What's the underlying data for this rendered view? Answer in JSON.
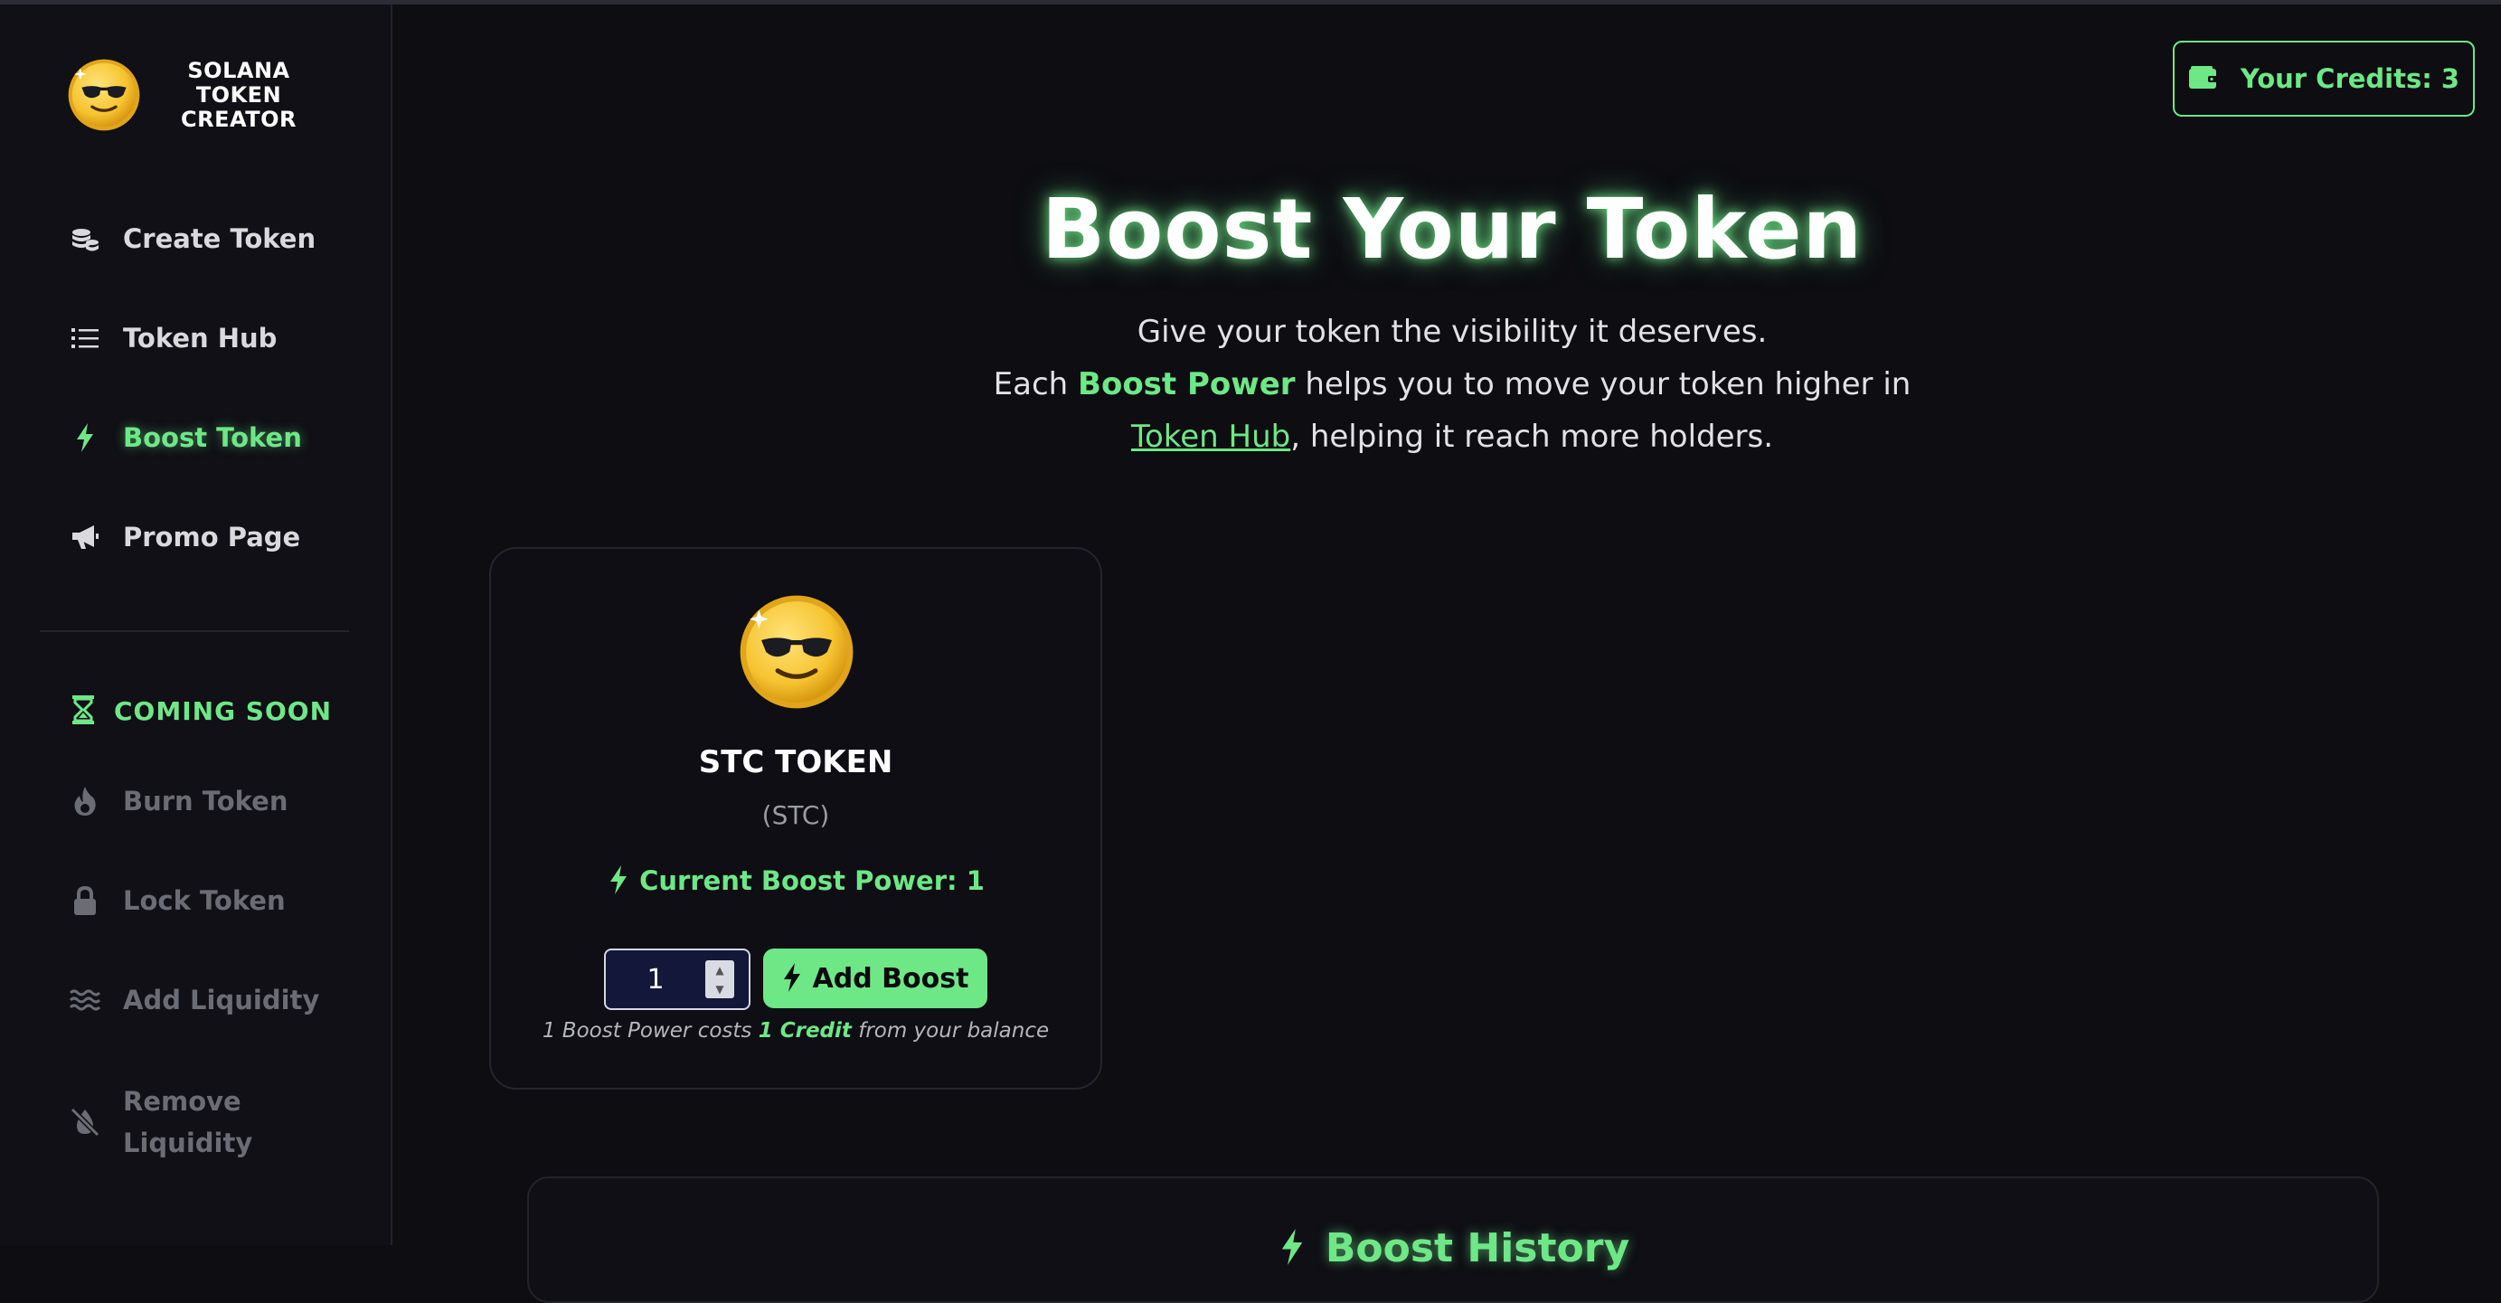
{
  "brand": {
    "name": "SOLANA TOKEN CREATOR",
    "logo_icon": "sunglasses-coin-icon"
  },
  "sidebar": {
    "items": [
      {
        "label": "Create Token",
        "icon": "coins-stack-icon",
        "state": "normal"
      },
      {
        "label": "Token Hub",
        "icon": "list-icon",
        "state": "normal"
      },
      {
        "label": "Boost Token",
        "icon": "bolt-icon",
        "state": "active"
      },
      {
        "label": "Promo Page",
        "icon": "megaphone-icon",
        "state": "normal"
      }
    ],
    "coming_soon_label": "COMING SOON",
    "coming_soon_items": [
      {
        "label": "Burn Token",
        "icon": "flame-icon"
      },
      {
        "label": "Lock Token",
        "icon": "lock-icon"
      },
      {
        "label": "Add Liquidity",
        "icon": "water-waves-icon"
      },
      {
        "label": "Remove\nLiquidity",
        "icon": "water-off-icon"
      }
    ]
  },
  "header": {
    "credits_label": "Your Credits: 3"
  },
  "hero": {
    "title": "Boost Your Token",
    "line1": "Give your token the visibility it deserves.",
    "line2_pre": "Each ",
    "line2_highlight": "Boost Power",
    "line2_post": " helps you to move your token higher in",
    "line3_link": "Token Hub",
    "line3_post": ", helping it reach more holders."
  },
  "token_card": {
    "name": "STC TOKEN",
    "symbol": "(STC)",
    "boost_power_label": "Current Boost Power: 1",
    "quantity": "1",
    "add_boost_label": "Add Boost",
    "cost_pre": "1 Boost Power costs ",
    "cost_highlight": "1 Credit",
    "cost_post": " from your balance"
  },
  "history": {
    "title": "Boost History"
  },
  "colors": {
    "accent": "#6ee787",
    "background": "#0d0d12",
    "sidebar": "#101016",
    "input_bg": "#13183a"
  }
}
